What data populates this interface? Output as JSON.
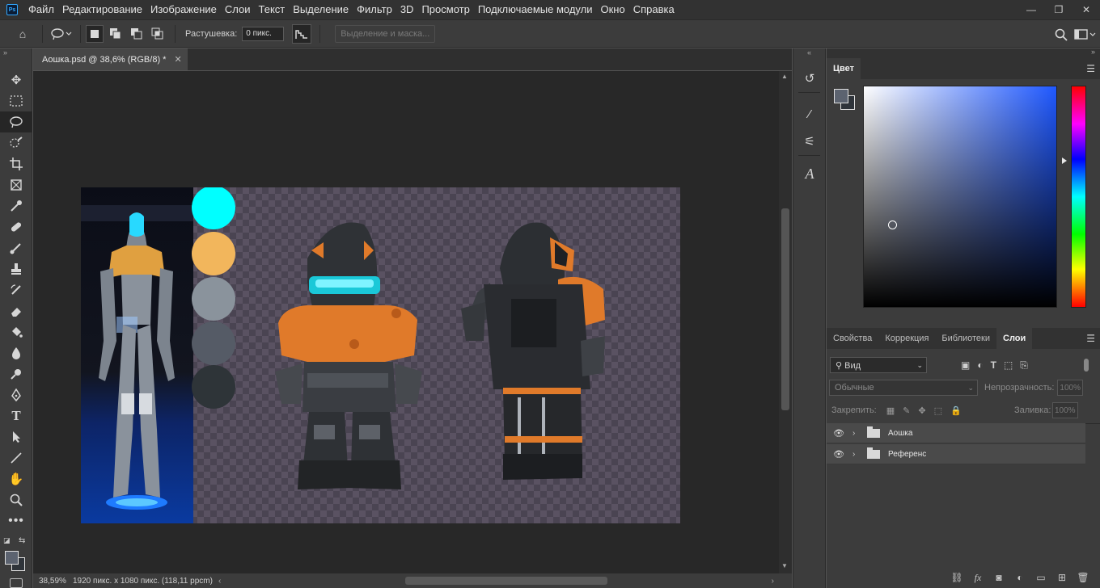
{
  "menubar": {
    "logo": "Ps",
    "items": [
      "Файл",
      "Редактирование",
      "Изображение",
      "Слои",
      "Текст",
      "Выделение",
      "Фильтр",
      "3D",
      "Просмотр",
      "Подключаемые модули",
      "Окно",
      "Справка"
    ]
  },
  "options": {
    "feather_label": "Растушевка:",
    "feather_value": "0 пикс.",
    "select_mask_label": "Выделение и маска..."
  },
  "document": {
    "tab_title": "Аошка.psd @ 38,6% (RGB/8) *",
    "zoom": "38,59%",
    "doc_info": "1920 пикс. x 1080 пикс. (118,11 ppcm)"
  },
  "swatches": {
    "colors": [
      "#00ffff",
      "#f2b65c",
      "#8a939c",
      "#555b66",
      "#2e3438"
    ]
  },
  "panels": {
    "color_tab": "Цвет",
    "color": {
      "foreground": "#5c6370",
      "background": "#2f343a"
    },
    "tabs": [
      "Свойства",
      "Коррекция",
      "Библиотеки",
      "Слои"
    ],
    "active_tab": "Слои",
    "layers": {
      "filter_label": "Вид",
      "blend_mode": "Обычные",
      "opacity_label": "Непрозрачность:",
      "opacity_value": "100%",
      "lock_label": "Закрепить:",
      "fill_label": "Заливка:",
      "fill_value": "100%",
      "items": [
        {
          "name": "Аошка",
          "visible": true,
          "type": "group"
        },
        {
          "name": "Референс",
          "visible": true,
          "type": "group"
        }
      ]
    }
  }
}
